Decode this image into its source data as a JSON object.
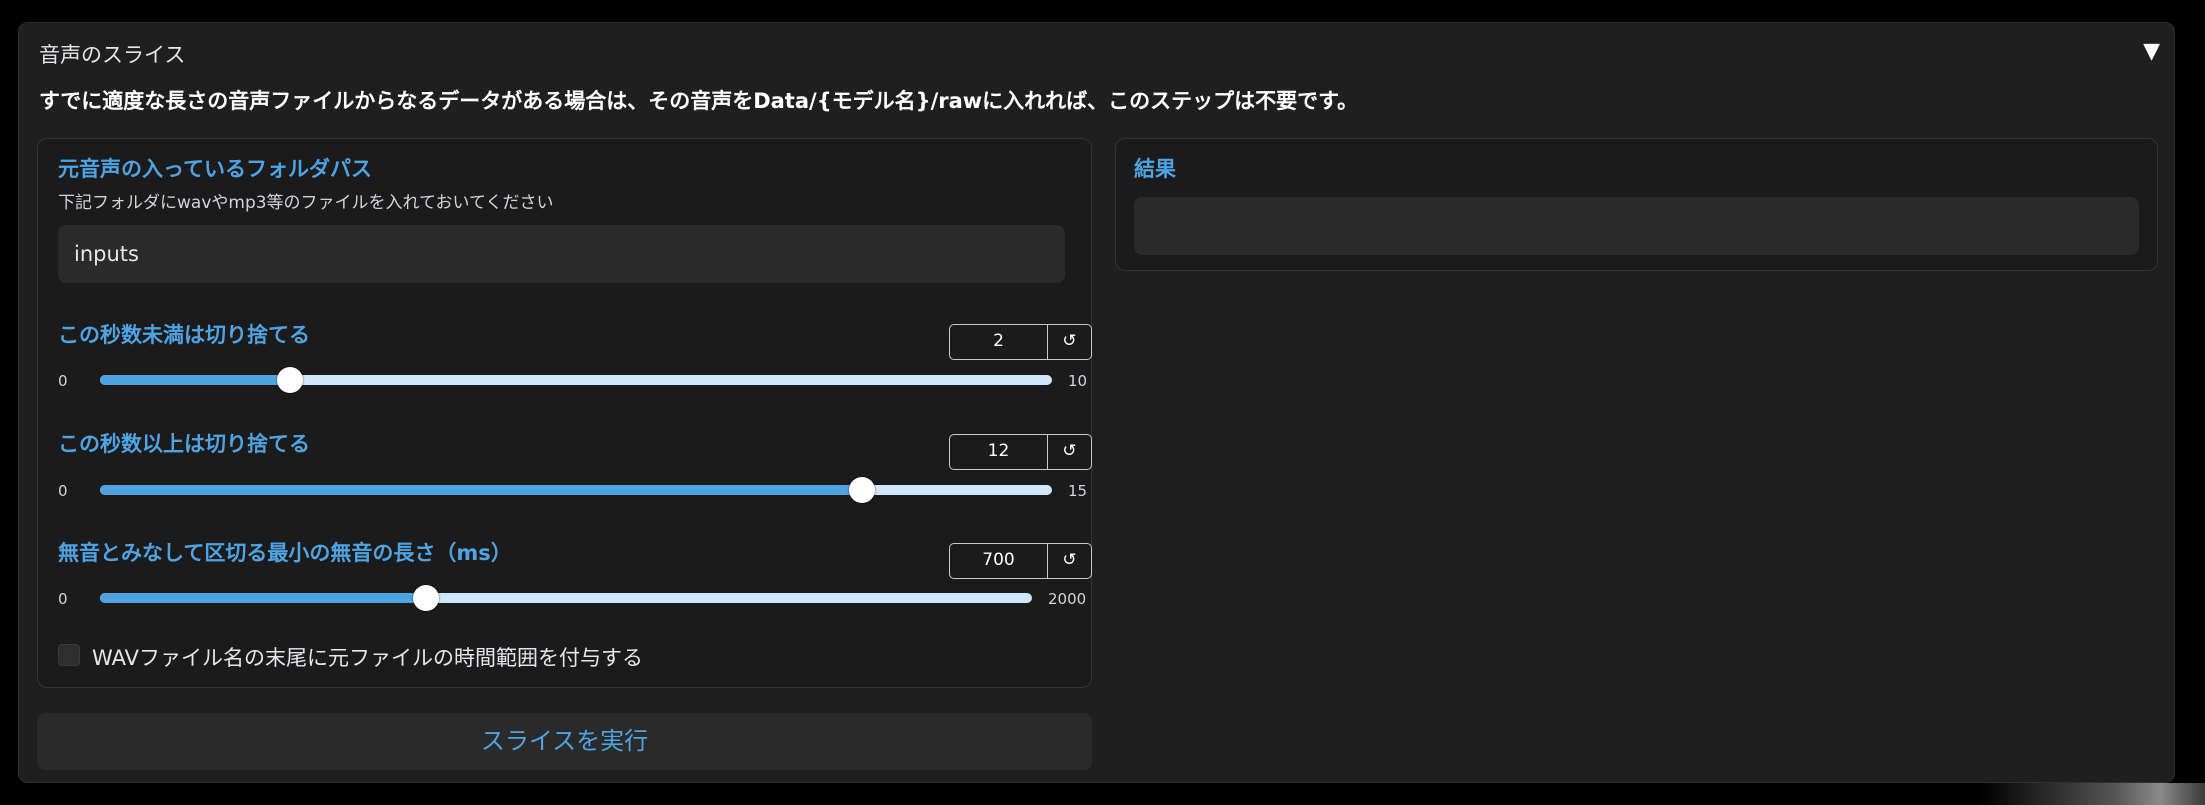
{
  "section": {
    "title": "音声のスライス",
    "toggle": "▼",
    "description": "すでに適度な長さの音声ファイルからなるデータがある場合は、その音声をData/{モデル名}/rawに入れれば、このステップは不要です。"
  },
  "input_folder": {
    "label": "元音声の入っているフォルダパス",
    "info": "下記フォルダにwavやmp3等のファイルを入れておいてください",
    "value": "inputs"
  },
  "sliders": [
    {
      "label": "この秒数未満は切り捨てる",
      "value": "2",
      "min": "0",
      "max": "10",
      "fraction": 0.2
    },
    {
      "label": "この秒数以上は切り捨てる",
      "value": "12",
      "min": "0",
      "max": "15",
      "fraction": 0.8
    },
    {
      "label": "無音とみなして区切る最小の無音の長さ（ms）",
      "value": "700",
      "min": "0",
      "max": "2000",
      "fraction": 0.35
    }
  ],
  "reset_icon": "↺",
  "checkbox": {
    "label": "WAVファイル名の末尾に元ファイルの時間範囲を付与する",
    "checked": false
  },
  "run_button": "スライスを実行",
  "result": {
    "label": "結果",
    "value": ""
  }
}
